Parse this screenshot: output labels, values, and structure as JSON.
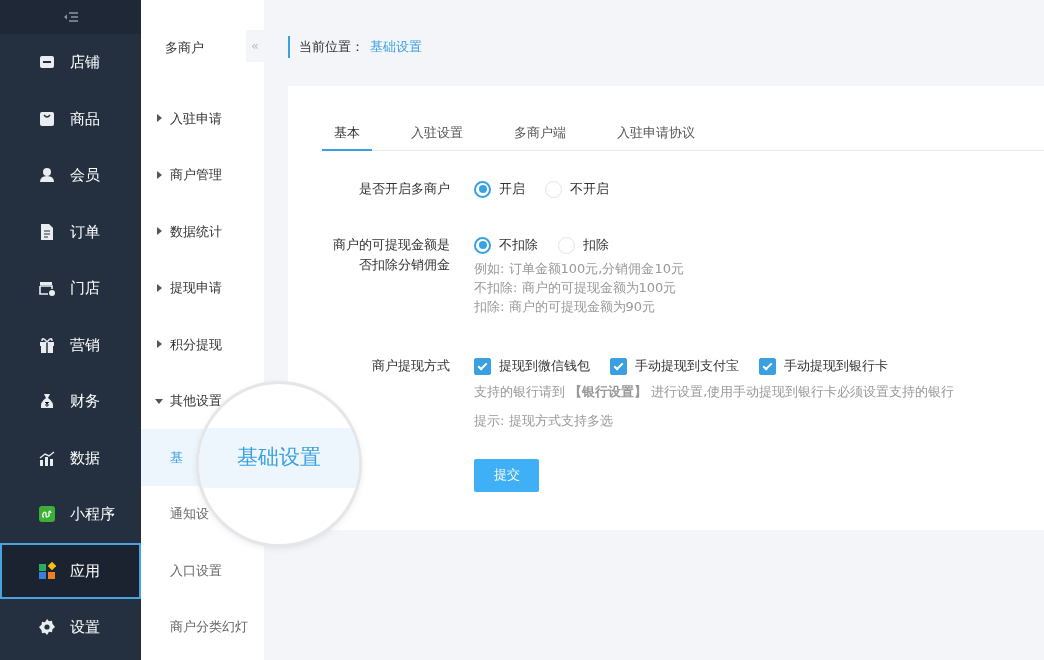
{
  "sidebar": {
    "items": [
      {
        "label": "店铺",
        "selected": false
      },
      {
        "label": "商品",
        "selected": false
      },
      {
        "label": "会员",
        "selected": false
      },
      {
        "label": "订单",
        "selected": false
      },
      {
        "label": "门店",
        "selected": false
      },
      {
        "label": "营销",
        "selected": false
      },
      {
        "label": "财务",
        "selected": false
      },
      {
        "label": "数据",
        "selected": false
      },
      {
        "label": "小程序",
        "selected": false
      },
      {
        "label": "应用",
        "selected": true
      },
      {
        "label": "设置",
        "selected": false
      }
    ]
  },
  "submenu": {
    "title": "多商户",
    "collapse": "«",
    "items": [
      {
        "label": "入驻申请",
        "expanded": false
      },
      {
        "label": "商户管理",
        "expanded": false
      },
      {
        "label": "数据统计",
        "expanded": false
      },
      {
        "label": "提现申请",
        "expanded": false
      },
      {
        "label": "积分提现",
        "expanded": false
      },
      {
        "label": "其他设置",
        "expanded": true,
        "children": [
          {
            "label": "基",
            "selected": true
          },
          {
            "label": "通知设",
            "selected": false
          },
          {
            "label": "入口设置",
            "selected": false
          },
          {
            "label": "商户分类幻灯",
            "selected": false
          }
        ]
      }
    ]
  },
  "magnifier": {
    "label": "基础设置"
  },
  "breadcrumb": {
    "prefix": "当前位置：",
    "current": "基础设置"
  },
  "tabs": [
    {
      "label": "基本",
      "selected": true
    },
    {
      "label": "入驻设置",
      "selected": false
    },
    {
      "label": "多商户端",
      "selected": false
    },
    {
      "label": "入驻申请协议",
      "selected": false
    }
  ],
  "form": [
    {
      "kind": "radio",
      "label": "是否开启多商户",
      "options": [
        {
          "label": "开启",
          "selected": true
        },
        {
          "label": "不开启",
          "selected": false
        }
      ]
    },
    {
      "kind": "radio",
      "label": "商户的可提现金额是否扣除分销佣金",
      "options": [
        {
          "label": "不扣除",
          "selected": true
        },
        {
          "label": "扣除",
          "selected": false
        }
      ],
      "help": [
        "例如: 订单金额100元,分销佣金10元",
        "不扣除: 商户的可提现金额为100元",
        "扣除: 商户的可提现金额为90元"
      ]
    },
    {
      "kind": "checkbox",
      "label": "商户提现方式",
      "options": [
        {
          "label": "提现到微信钱包",
          "checked": true
        },
        {
          "label": "手动提现到支付宝",
          "checked": true
        },
        {
          "label": "手动提现到银行卡",
          "checked": true
        }
      ],
      "help": [
        "支持的银行请到 **【银行设置】** 进行设置,使用手动提现到银行卡必须设置支持的银行"
      ],
      "hint": "提示: 提现方式支持多选"
    }
  ],
  "submit": "提交"
}
